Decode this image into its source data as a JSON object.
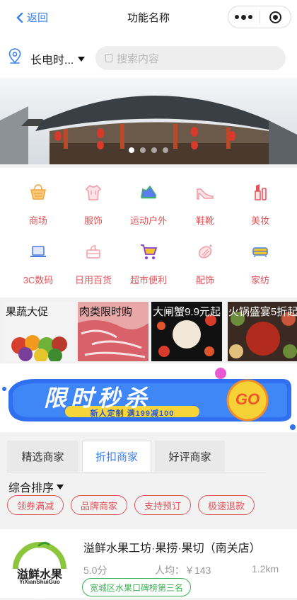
{
  "nav": {
    "back_label": "返回",
    "title": "功能名称"
  },
  "location": {
    "city": "长电时...",
    "search_placeholder": "搜索内容"
  },
  "banner": {
    "slides": 4,
    "active_slide": 1
  },
  "categories": [
    {
      "label": "商场",
      "icon": "basket-icon",
      "color": "#f0a43c"
    },
    {
      "label": "服饰",
      "icon": "hoodie-icon",
      "color": "#f29aa6"
    },
    {
      "label": "运动户外",
      "icon": "sneaker-icon",
      "color": "#3bb36a"
    },
    {
      "label": "鞋靴",
      "icon": "high-heel-icon",
      "color": "#f29aa6"
    },
    {
      "label": "美妆",
      "icon": "lipstick-icon",
      "color": "#e2555b"
    },
    {
      "label": "3C数码",
      "icon": "laptop-icon",
      "color": "#4a7be0"
    },
    {
      "label": "日用百货",
      "icon": "tissue-box-icon",
      "color": "#f29aa6"
    },
    {
      "label": "超市便利",
      "icon": "shopping-cart-icon",
      "color": "#8a3fd6"
    },
    {
      "label": "配饰",
      "icon": "accessory-icon",
      "color": "#f29aa6"
    },
    {
      "label": "家纺",
      "icon": "bedding-icon",
      "color": "#4a7be0"
    }
  ],
  "promos": [
    {
      "label": "果蔬大促"
    },
    {
      "label": "肉类限时购"
    },
    {
      "label": "大闸蟹9.9元起"
    },
    {
      "label": "火锅盛宴5折起"
    }
  ],
  "seckill": {
    "title": "限时秒杀",
    "subtitle": "新人定制 满199减100",
    "go": "GO"
  },
  "tabs": [
    "精选商家",
    "折扣商家",
    "好评商家"
  ],
  "active_tab": "折扣商家",
  "sort_label": "综合排序",
  "filters": [
    "领券满减",
    "品牌商家",
    "支持预订",
    "极速退款"
  ],
  "shop": {
    "name": "溢鲜水果工坊·果捞·果切（南关店）",
    "score": "5.0分",
    "avg_price": "人均：￥143",
    "distance": "1.2km",
    "rank": "宽城区水果口碑榜第三名",
    "logo_text": "溢鲜水果",
    "logo_sub": "YiXianShuiGuo"
  }
}
